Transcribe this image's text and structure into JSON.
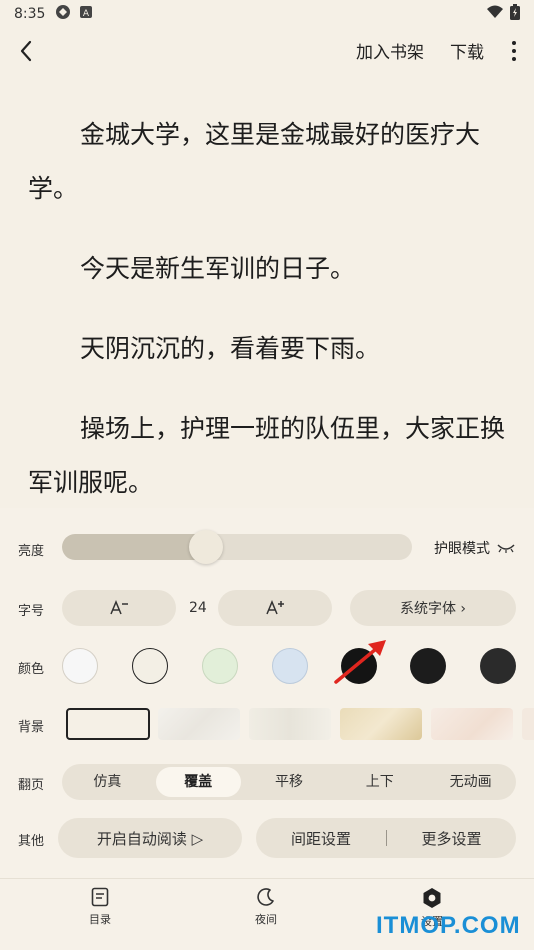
{
  "status_bar": {
    "time": "8:35"
  },
  "toolbar": {
    "add_shelf": "加入书架",
    "download": "下载"
  },
  "content": {
    "paragraphs": [
      "金城大学，这里是金城最好的医疗大学。",
      "今天是新生军训的日子。",
      "天阴沉沉的，看着要下雨。",
      "操场上，护理一班的队伍里，大家正换军训服呢。"
    ]
  },
  "settings": {
    "brightness": {
      "label": "亮度",
      "level": 0.41,
      "eye_mode": "护眼模式"
    },
    "font_size": {
      "label": "字号",
      "value": "24",
      "font": "系统字体 ›"
    },
    "color": {
      "label": "颜色",
      "swatches": [
        "#f7f7f7",
        "#f3efe5",
        "#e2efd9",
        "#d7e3f0",
        "#141414",
        "#1c1c1c",
        "#2b2b2b"
      ]
    },
    "background": {
      "label": "背景"
    },
    "page_turn": {
      "label": "翻页",
      "options": [
        "仿真",
        "覆盖",
        "平移",
        "上下",
        "无动画"
      ],
      "selected": "覆盖"
    },
    "other": {
      "label": "其他",
      "auto_read": "开启自动阅读 ▷",
      "spacing": "间距设置",
      "more": "更多设置"
    }
  },
  "bottom_nav": {
    "toc": "目录",
    "night": "夜间",
    "settings": "设置"
  },
  "watermark": "ITMOP.COM"
}
